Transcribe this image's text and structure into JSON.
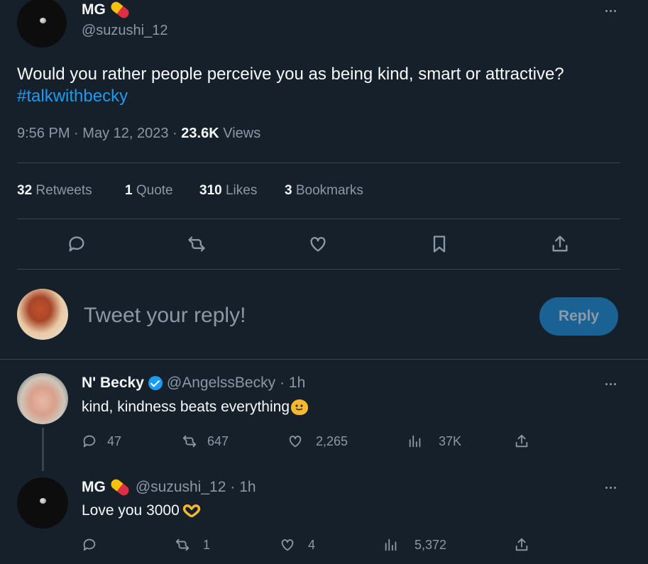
{
  "main_tweet": {
    "display_name": "MG",
    "handle": "@suzushi_12",
    "text": "Would you rather people perceive you as being kind, smart or attractive?",
    "hashtag": "#talkwithbecky",
    "time": "9:56 PM",
    "date": "May 12, 2023",
    "views_count": "23.6K",
    "views_label": "Views",
    "sep": "·",
    "stats": {
      "retweets_count": "32",
      "retweets_label": "Retweets",
      "quotes_count": "1",
      "quotes_label": "Quote",
      "likes_count": "310",
      "likes_label": "Likes",
      "bookmarks_count": "3",
      "bookmarks_label": "Bookmarks"
    }
  },
  "reply_box": {
    "placeholder": "Tweet your reply!",
    "button_label": "Reply"
  },
  "replies": [
    {
      "display_name": "N' Becky",
      "handle": "@AngelssBecky",
      "time": "· 1h",
      "text": "kind, kindness beats everything",
      "reply_count": "47",
      "retweet_count": "647",
      "like_count": "2,265",
      "view_count": "37K"
    },
    {
      "display_name": "MG",
      "handle": "@suzushi_12",
      "time": "· 1h",
      "text": "Love you 3000",
      "reply_count": "",
      "retweet_count": "1",
      "like_count": "4",
      "view_count": "5,372"
    }
  ],
  "colors": {
    "background": "#15202b",
    "text": "#f7f9f9",
    "muted": "#8b98a5",
    "link": "#1d9bf0",
    "border": "#38444d",
    "reply_button": "#1a6194"
  }
}
